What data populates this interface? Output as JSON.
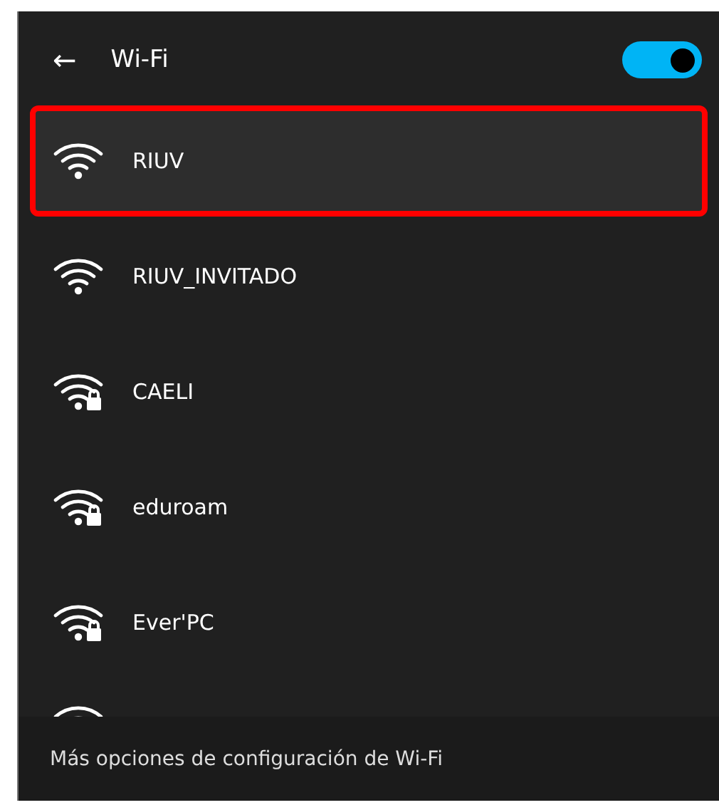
{
  "header": {
    "back": "←",
    "title": "Wi-Fi",
    "wifi_on": true
  },
  "networks": [
    {
      "kind": "network",
      "name": "RIUV",
      "secured": false,
      "selected": true,
      "annotated": true
    },
    {
      "kind": "network",
      "name": "RIUV_INVITADO",
      "secured": false,
      "selected": false,
      "annotated": false
    },
    {
      "kind": "network",
      "name": "CAELI",
      "secured": true,
      "selected": false,
      "annotated": false
    },
    {
      "kind": "network",
      "name": "eduroam",
      "secured": true,
      "selected": false,
      "annotated": false
    },
    {
      "kind": "network",
      "name": "Ever'PC",
      "secured": true,
      "selected": false,
      "annotated": false
    },
    {
      "kind": "cut-off"
    }
  ],
  "footer": {
    "link": "Más opciones de configuración de Wi-Fi"
  }
}
